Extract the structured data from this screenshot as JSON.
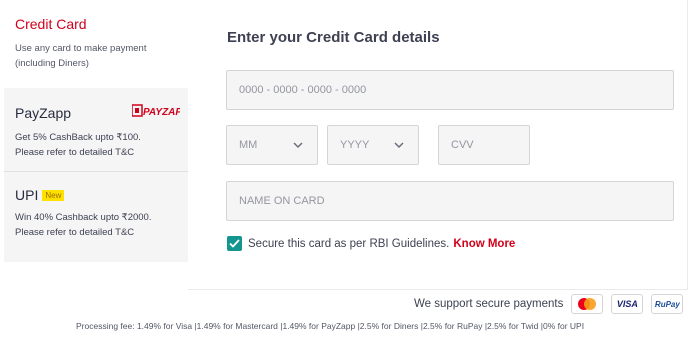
{
  "sidebar": {
    "credit_card": {
      "title": "Credit Card",
      "desc_line1": "Use any card to make payment",
      "desc_line2": "(including Diners)"
    },
    "payzapp": {
      "title": "PayZapp",
      "logo_text": "PAYZAPP",
      "desc_line1": "Get 5% CashBack upto ₹100.",
      "desc_line2": "Please refer to detailed T&C"
    },
    "upi": {
      "title": "UPI",
      "badge": "New",
      "desc_line1": "Win 40% Cashback upto ₹2000.",
      "desc_line2": "Please refer to detailed T&C"
    }
  },
  "form": {
    "title": "Enter your Credit Card details",
    "card_number_placeholder": "0000 - 0000 - 0000 - 0000",
    "month_placeholder": "MM",
    "year_placeholder": "YYYY",
    "cvv_placeholder": "CVV",
    "name_placeholder": "NAME ON CARD",
    "secure_label": "Secure this card as per RBI Guidelines.",
    "secure_checked": true,
    "know_more": "Know More"
  },
  "support": {
    "label": "We support secure payments",
    "cards": [
      "mastercard-icon",
      "visa-icon",
      "rupay-icon"
    ],
    "visa_text": "VISA",
    "rupay_text": "RuPay"
  },
  "fees": "Processing fee: 1.49% for Visa |1.49% for Mastercard |1.49% for PayZapp |2.5% for Diners |2.5% for RuPay |2.5% for Twid |0% for UPI",
  "colors": {
    "accent": "#d0021b",
    "checkbox": "#14958f",
    "upi_badge": "#ffe100"
  }
}
